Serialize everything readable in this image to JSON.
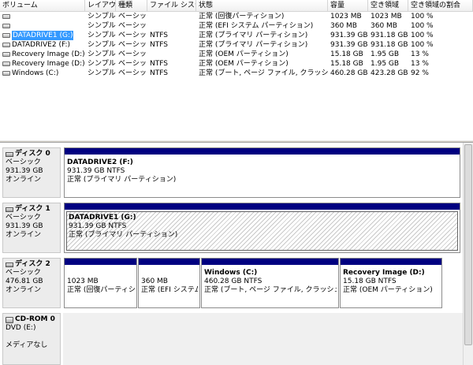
{
  "volume_list": {
    "headers": [
      "ボリューム",
      "レイアウト",
      "種類",
      "ファイル システム",
      "状態",
      "容量",
      "空き領域",
      "空き領域の割合"
    ],
    "rows": [
      {
        "name": "",
        "layout": "シンプル",
        "type": "ベーシック",
        "fs": "",
        "status": "正常 (回復パーティション)",
        "capacity": "1023 MB",
        "free": "1023 MB",
        "pct": "100 %",
        "selected": false
      },
      {
        "name": "",
        "layout": "シンプル",
        "type": "ベーシック",
        "fs": "",
        "status": "正常 (EFI システム パーティション)",
        "capacity": "360 MB",
        "free": "360 MB",
        "pct": "100 %",
        "selected": false
      },
      {
        "name": "DATADRIVE1 (G:)",
        "layout": "シンプル",
        "type": "ベーシック",
        "fs": "NTFS",
        "status": "正常 (プライマリ パーティション)",
        "capacity": "931.39 GB",
        "free": "931.18 GB",
        "pct": "100 %",
        "selected": true
      },
      {
        "name": "DATADRIVE2 (F:)",
        "layout": "シンプル",
        "type": "ベーシック",
        "fs": "NTFS",
        "status": "正常 (プライマリ パーティション)",
        "capacity": "931.39 GB",
        "free": "931.18 GB",
        "pct": "100 %",
        "selected": false
      },
      {
        "name": "Recovery Image (D:)",
        "layout": "シンプル",
        "type": "ベーシック",
        "fs": "",
        "status": "正常 (OEM パーティション)",
        "capacity": "15.18 GB",
        "free": "1.95 GB",
        "pct": "13 %",
        "selected": false
      },
      {
        "name": "Recovery Image (D:)",
        "layout": "シンプル",
        "type": "ベーシック",
        "fs": "NTFS",
        "status": "正常 (OEM パーティション)",
        "capacity": "15.18 GB",
        "free": "1.95 GB",
        "pct": "13 %",
        "selected": false
      },
      {
        "name": "Windows (C:)",
        "layout": "シンプル",
        "type": "ベーシック",
        "fs": "NTFS",
        "status": "正常 (ブート, ページ ファイル, クラッシュ ダン...",
        "capacity": "460.28 GB",
        "free": "423.28 GB",
        "pct": "92 %",
        "selected": false
      }
    ]
  },
  "disks": [
    {
      "title": "ディスク 0",
      "type": "ベーシック",
      "size": "931.39 GB",
      "state": "オンライン",
      "partitions": [
        {
          "name": "DATADRIVE2  (F:)",
          "size": "931.39 GB NTFS",
          "status": "正常 (プライマリ パーティション)",
          "hatched": false
        }
      ]
    },
    {
      "title": "ディスク 1",
      "type": "ベーシック",
      "size": "931.39 GB",
      "state": "オンライン",
      "partitions": [
        {
          "name": "DATADRIVE1  (G:)",
          "size": "931.39 GB NTFS",
          "status": "正常 (プライマリ パーティション)",
          "hatched": true
        }
      ]
    },
    {
      "title": "ディスク 2",
      "type": "ベーシック",
      "size": "476.81 GB",
      "state": "オンライン",
      "partitions": [
        {
          "name": "",
          "size": "1023 MB",
          "status": "正常 (回復パーティショ",
          "hatched": false
        },
        {
          "name": "",
          "size": "360 MB",
          "status": "正常 (EFI システム",
          "hatched": false
        },
        {
          "name": "Windows  (C:)",
          "size": "460.28 GB NTFS",
          "status": "正常 (ブート, ページ ファイル, クラッシュ ダンプ, プ",
          "hatched": false
        },
        {
          "name": "Recovery Image  (D:)",
          "size": "15.18 GB NTFS",
          "status": "正常 (OEM パーティション)",
          "hatched": false
        }
      ]
    }
  ],
  "cdrom": {
    "title": "CD-ROM 0",
    "drive": "DVD (E:)",
    "media": "メディアなし"
  }
}
